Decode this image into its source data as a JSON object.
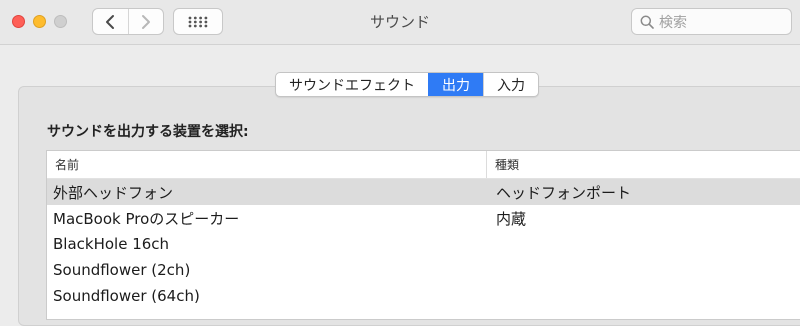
{
  "window": {
    "title": "サウンド"
  },
  "search": {
    "placeholder": "検索"
  },
  "tabs": [
    {
      "label": "サウンドエフェクト",
      "active": false
    },
    {
      "label": "出力",
      "active": true
    },
    {
      "label": "入力",
      "active": false
    }
  ],
  "section": {
    "label": "サウンドを出力する装置を選択:"
  },
  "table": {
    "columns": {
      "name": "名前",
      "type": "種類"
    },
    "rows": [
      {
        "name": "外部ヘッドフォン",
        "type": "ヘッドフォンポート",
        "selected": true
      },
      {
        "name": "MacBook Proのスピーカー",
        "type": "内蔵",
        "selected": false
      },
      {
        "name": "BlackHole 16ch",
        "type": "",
        "selected": false
      },
      {
        "name": "Soundflower (2ch)",
        "type": "",
        "selected": false
      },
      {
        "name": "Soundflower (64ch)",
        "type": "",
        "selected": false
      }
    ]
  },
  "colors": {
    "accent": "#2f7bf5",
    "selected_row": "#dcdcdc",
    "close": "#fe5f57",
    "minimize": "#febc2e"
  }
}
